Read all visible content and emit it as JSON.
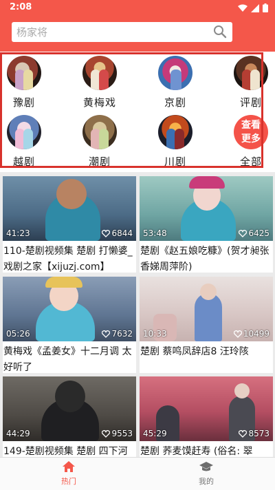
{
  "status_bar": {
    "time": "2:08"
  },
  "search": {
    "placeholder": "杨家将"
  },
  "categories": [
    {
      "label": "豫剧"
    },
    {
      "label": "黄梅戏"
    },
    {
      "label": "京剧"
    },
    {
      "label": "评剧"
    },
    {
      "label": "越剧"
    },
    {
      "label": "潮剧"
    },
    {
      "label": "川剧"
    },
    {
      "label": "全部"
    }
  ],
  "more_button": {
    "line1": "查看",
    "line2": "更多"
  },
  "videos": [
    {
      "duration": "41:23",
      "likes": "6844",
      "title": "110-楚剧视频集 楚剧 打懒婆_戏剧之家【xijuzj.com】"
    },
    {
      "duration": "53:48",
      "likes": "6425",
      "title": "楚剧《赵五娘吃糠》(贺才昶张香娣周萍阶)"
    },
    {
      "duration": "05:26",
      "likes": "7632",
      "title": "黄梅戏《孟姜女》十二月调 太好听了"
    },
    {
      "duration": "10:33",
      "likes": "10499",
      "title": "楚剧 蔡鸣凤辞店8 汪玲陔"
    },
    {
      "duration": "44:29",
      "likes": "9553",
      "title": "149-楚剧视频集 楚剧 四下河"
    },
    {
      "duration": "45:29",
      "likes": "8573",
      "title": "楚剧 荞麦馍赶寿 (俗名: 翠"
    }
  ],
  "bottom_nav": [
    {
      "label": "热门",
      "icon": "home-icon",
      "active": true
    },
    {
      "label": "我的",
      "icon": "graduation-cap-icon",
      "active": false
    }
  ],
  "colors": {
    "header": "#f4574a",
    "accent": "#f4574a",
    "frame": "#d8322c"
  }
}
